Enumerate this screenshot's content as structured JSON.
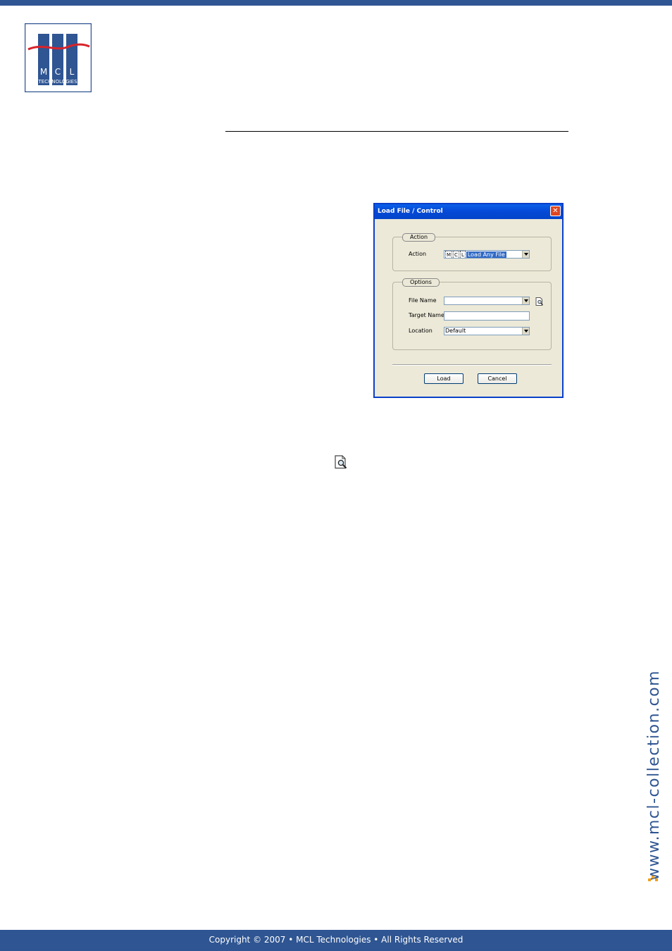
{
  "logo": {
    "letters": [
      "M",
      "C",
      "L"
    ],
    "caption": "TECHNOLOGIES"
  },
  "dialog": {
    "title": "Load File / Control",
    "close_glyph": "✕",
    "action_group": {
      "legend": "Action",
      "action_label": "Action",
      "action_chips": [
        "M",
        "C",
        "L"
      ],
      "action_value": "Load Any File"
    },
    "options_group": {
      "legend": "Options",
      "file_name_label": "File Name",
      "file_name_value": "",
      "target_name_label": "Target Name",
      "target_name_value": "",
      "location_label": "Location",
      "location_value": "Default"
    },
    "buttons": {
      "load": "Load",
      "cancel": "Cancel"
    }
  },
  "side_url": "www.mcl-collection.com",
  "footer": "Copyright © 2007 • MCL Technologies • All Rights Reserved",
  "colors": {
    "brand_blue": "#2f5592",
    "logo_red": "#d8232a",
    "accent_orange": "#f0a01e"
  },
  "icons": [
    "mcl-logo",
    "browse-file-icon",
    "close-icon",
    "dropdown-arrow-icon",
    "url-dots-icon"
  ]
}
